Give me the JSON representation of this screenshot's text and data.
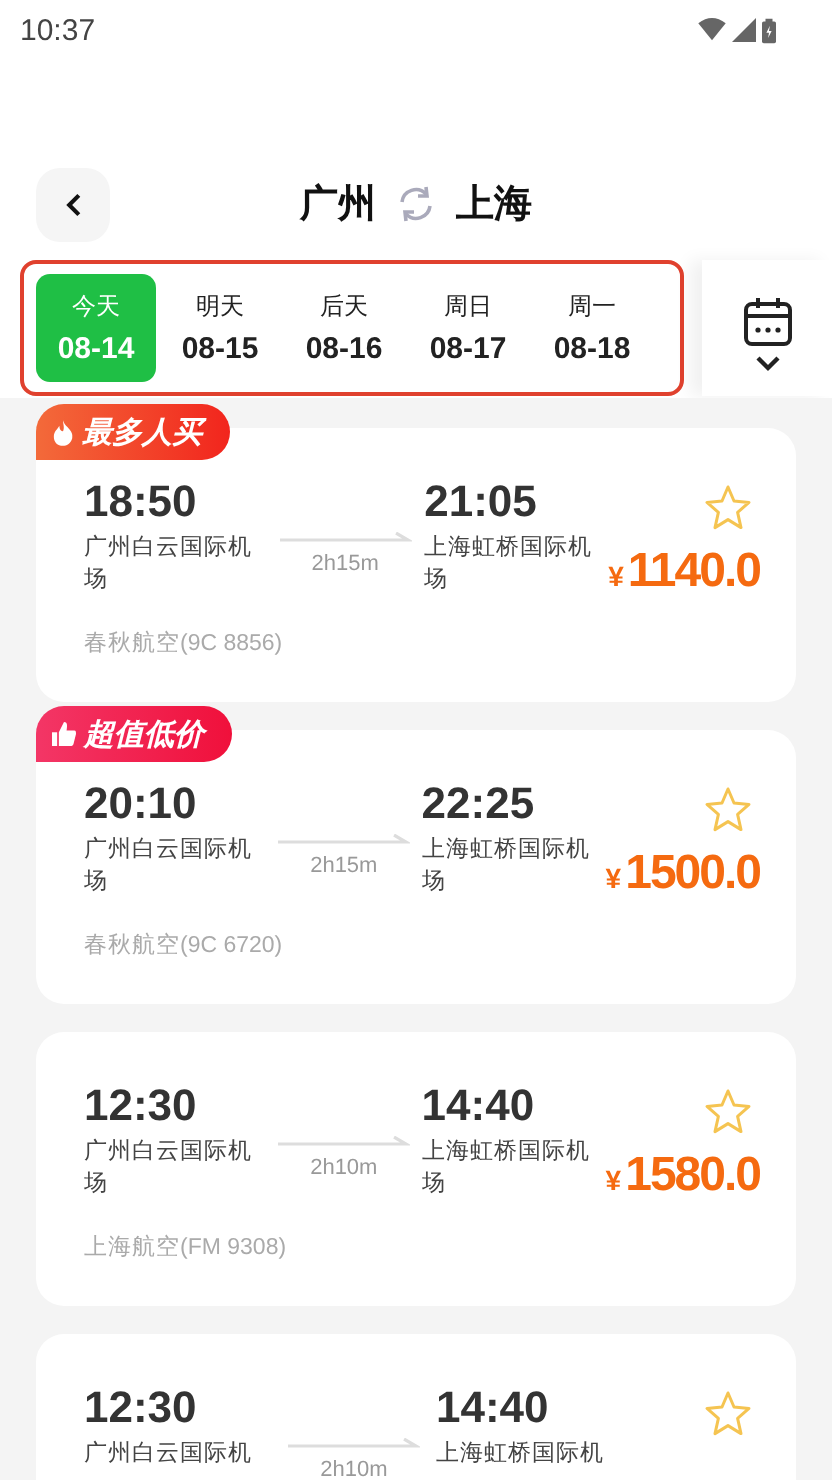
{
  "status_bar": {
    "time": "10:37"
  },
  "header": {
    "from": "广州",
    "to": "上海"
  },
  "dates": [
    {
      "label": "今天",
      "date": "08-14",
      "selected": true
    },
    {
      "label": "明天",
      "date": "08-15",
      "selected": false
    },
    {
      "label": "后天",
      "date": "08-16",
      "selected": false
    },
    {
      "label": "周日",
      "date": "08-17",
      "selected": false
    },
    {
      "label": "周一",
      "date": "08-18",
      "selected": false
    }
  ],
  "flights": [
    {
      "badge": {
        "kind": "popular",
        "text": "最多人买"
      },
      "depart_time": "18:50",
      "depart_airport": "广州白云国际机场",
      "duration": "2h15m",
      "arrive_time": "21:05",
      "arrive_airport": "上海虹桥国际机场",
      "currency": "¥",
      "price": "1140.0",
      "favorite": false,
      "airline": "春秋航空(9C 8856)"
    },
    {
      "badge": {
        "kind": "value",
        "text": "超值低价"
      },
      "depart_time": "20:10",
      "depart_airport": "广州白云国际机场",
      "duration": "2h15m",
      "arrive_time": "22:25",
      "arrive_airport": "上海虹桥国际机场",
      "currency": "¥",
      "price": "1500.0",
      "favorite": false,
      "airline": "春秋航空(9C 6720)"
    },
    {
      "depart_time": "12:30",
      "depart_airport": "广州白云国际机场",
      "duration": "2h10m",
      "arrive_time": "14:40",
      "arrive_airport": "上海虹桥国际机场",
      "currency": "¥",
      "price": "1580.0",
      "favorite": false,
      "airline": "上海航空(FM 9308)"
    },
    {
      "depart_time": "12:30",
      "depart_airport": "广州白云国际机",
      "duration": "2h10m",
      "arrive_time": "14:40",
      "arrive_airport": "上海虹桥国际机",
      "favorite": false
    }
  ]
}
